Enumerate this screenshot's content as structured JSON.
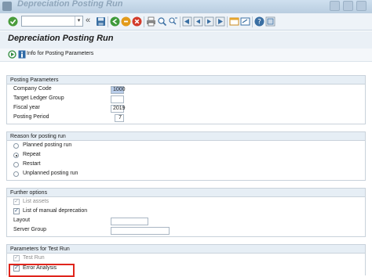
{
  "window": {
    "title": "Depreciation Posting Run"
  },
  "toolbar": {
    "command_field_value": "",
    "command_dropdown": "▾",
    "back_glyph": "«"
  },
  "header": {
    "title": "Depreciation Posting Run"
  },
  "app_toolbar": {
    "info_label": "Info for Posting Parameters"
  },
  "posting_parameters": {
    "title": "Posting Parameters",
    "fields": [
      {
        "label": "Company Code",
        "value": "1000"
      },
      {
        "label": "Target Ledger Group",
        "value": ""
      },
      {
        "label": "Fiscal year",
        "value": "2019"
      },
      {
        "label": "Posting Period",
        "value": "7"
      }
    ]
  },
  "reason": {
    "title": "Reason for posting run",
    "options": [
      {
        "label": "Planned posting run",
        "selected": false
      },
      {
        "label": "Repeat",
        "selected": true
      },
      {
        "label": "Restart",
        "selected": false
      },
      {
        "label": "Unplanned posting run",
        "selected": false
      }
    ]
  },
  "further": {
    "title": "Further options",
    "list_assets": {
      "label": "List assets",
      "checked": true,
      "enabled": false
    },
    "list_manual": {
      "label": "List of manual deprecation",
      "checked": true,
      "enabled": true
    },
    "layout": {
      "label": "Layout",
      "value": ""
    },
    "server_group": {
      "label": "Server Group",
      "value": ""
    }
  },
  "test_run": {
    "title": "Parameters for Test Run",
    "test_run": {
      "label": "Test Run",
      "checked": true,
      "enabled": false
    },
    "error_analysis": {
      "label": "Error Analysis",
      "checked": true,
      "enabled": true
    }
  },
  "checkmark": "✓",
  "colors": {
    "highlight_box": "#e0251c",
    "header_bg": "#eaf0f6",
    "group_title_bg": "#e6eef5"
  }
}
